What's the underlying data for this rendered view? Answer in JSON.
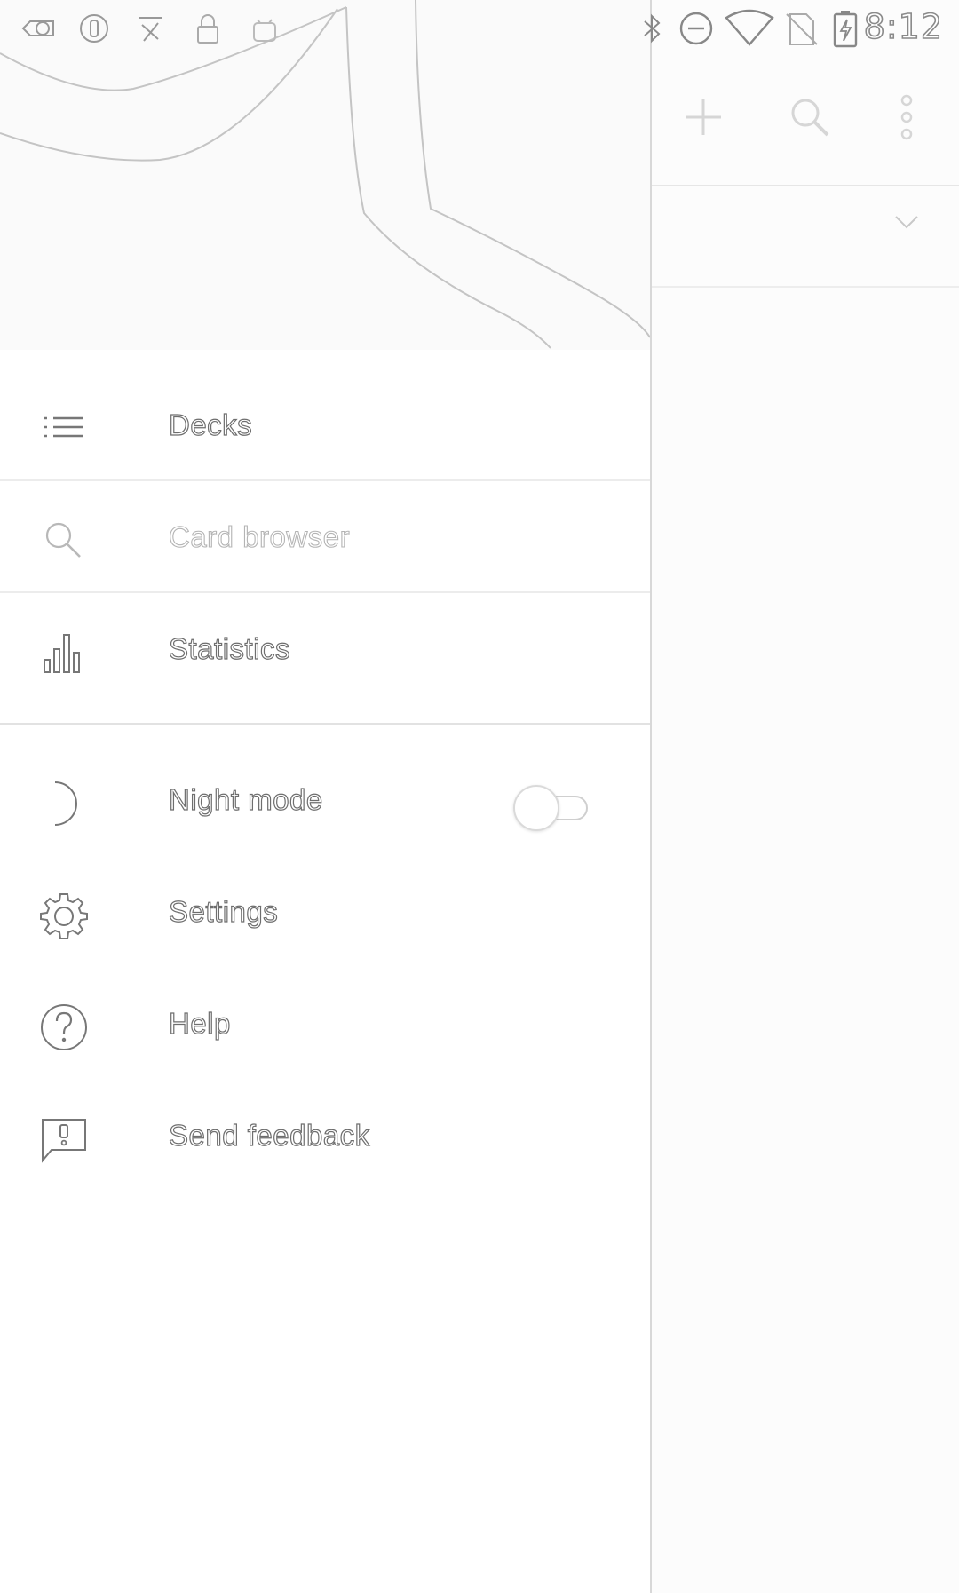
{
  "status_bar": {
    "time": "8:12",
    "left_icons": [
      "notification-badge-icon",
      "circle-status-icon",
      "app-notification-icon",
      "lock-icon",
      "android-icon"
    ],
    "right_icons": [
      "bluetooth-icon",
      "do-not-disturb-icon",
      "wifi-icon",
      "no-sim-icon",
      "battery-charging-icon"
    ]
  },
  "drawer": {
    "items": [
      {
        "label": "Decks",
        "icon": "list-icon"
      },
      {
        "label": "Card browser",
        "icon": "search-icon"
      },
      {
        "label": "Statistics",
        "icon": "bar-chart-icon"
      },
      {
        "label": "Night mode",
        "icon": "moon-icon",
        "toggle_on": false
      },
      {
        "label": "Settings",
        "icon": "gear-icon"
      },
      {
        "label": "Help",
        "icon": "help-icon"
      },
      {
        "label": "Send feedback",
        "icon": "feedback-icon"
      }
    ]
  },
  "toolbar": {
    "actions": [
      "add-icon",
      "search-icon",
      "more-vert-icon"
    ]
  },
  "colors": {
    "drawer_bg": "#ffffff",
    "divider": "#e2e2e2",
    "text": "#6e6e6e",
    "text_dim": "#b4b4b4"
  }
}
